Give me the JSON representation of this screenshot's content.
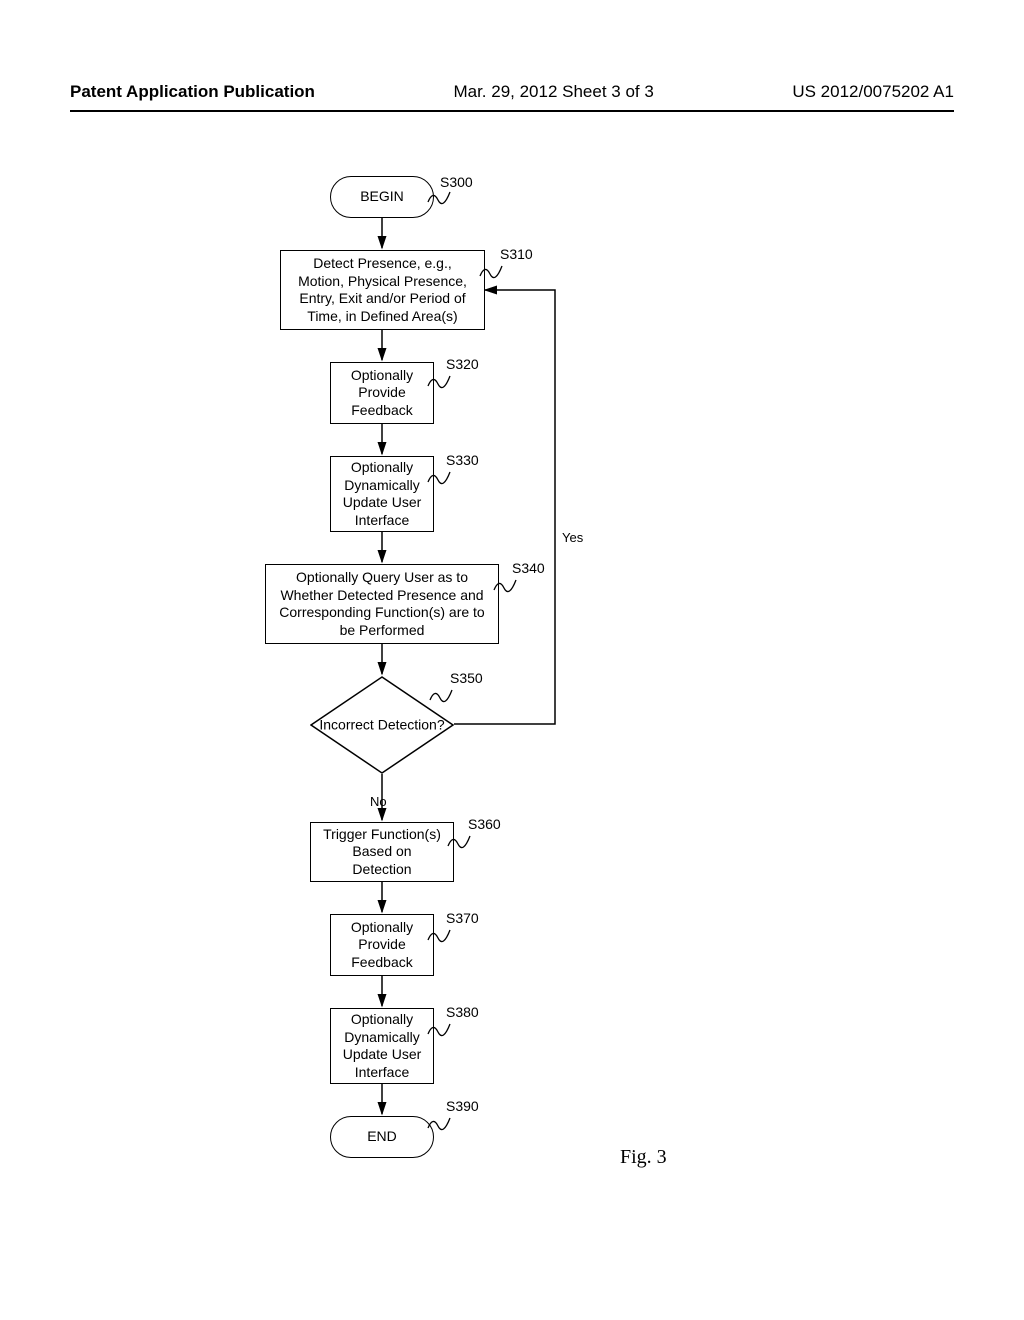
{
  "header": {
    "left": "Patent Application Publication",
    "center": "Mar. 29, 2012  Sheet 3 of 3",
    "right": "US 2012/0075202 A1"
  },
  "chart_data": {
    "type": "flowchart",
    "title": "Fig. 3",
    "nodes": [
      {
        "id": "S300",
        "kind": "terminator",
        "label": "BEGIN"
      },
      {
        "id": "S310",
        "kind": "process",
        "label": "Detect Presence, e.g., Motion, Physical Presence, Entry, Exit and/or Period of Time, in Defined Area(s)"
      },
      {
        "id": "S320",
        "kind": "process",
        "label": "Optionally Provide Feedback"
      },
      {
        "id": "S330",
        "kind": "process",
        "label": "Optionally Dynamically Update User Interface"
      },
      {
        "id": "S340",
        "kind": "process",
        "label": "Optionally Query User as to Whether Detected Presence and Corresponding Function(s) are to be Performed"
      },
      {
        "id": "S350",
        "kind": "decision",
        "label": "Incorrect Detection?"
      },
      {
        "id": "S360",
        "kind": "process",
        "label": "Trigger Function(s) Based on Detection"
      },
      {
        "id": "S370",
        "kind": "process",
        "label": "Optionally Provide Feedback"
      },
      {
        "id": "S380",
        "kind": "process",
        "label": "Optionally Dynamically Update User Interface"
      },
      {
        "id": "S390",
        "kind": "terminator",
        "label": "END"
      }
    ],
    "edges": [
      {
        "from": "S300",
        "to": "S310"
      },
      {
        "from": "S310",
        "to": "S320"
      },
      {
        "from": "S320",
        "to": "S330"
      },
      {
        "from": "S330",
        "to": "S340"
      },
      {
        "from": "S340",
        "to": "S350"
      },
      {
        "from": "S350",
        "to": "S360",
        "label": "No"
      },
      {
        "from": "S350",
        "to": "S310",
        "label": "Yes"
      },
      {
        "from": "S360",
        "to": "S370"
      },
      {
        "from": "S370",
        "to": "S380"
      },
      {
        "from": "S380",
        "to": "S390"
      }
    ]
  },
  "steps": {
    "s300": {
      "id": "S300",
      "label": "BEGIN"
    },
    "s310": {
      "id": "S310",
      "label": "Detect Presence, e.g., Motion, Physical Presence, Entry, Exit and/or Period of Time, in Defined Area(s)"
    },
    "s320": {
      "id": "S320",
      "label": "Optionally Provide Feedback"
    },
    "s330": {
      "id": "S330",
      "label": "Optionally Dynamically Update User Interface"
    },
    "s340": {
      "id": "S340",
      "label": "Optionally Query User as to Whether Detected Presence and Corresponding Function(s) are to be Performed"
    },
    "s350": {
      "id": "S350",
      "label": "Incorrect Detection?"
    },
    "s360": {
      "id": "S360",
      "label": "Trigger Function(s) Based on Detection"
    },
    "s370": {
      "id": "S370",
      "label": "Optionally Provide Feedback"
    },
    "s380": {
      "id": "S380",
      "label": "Optionally Dynamically Update User Interface"
    },
    "s390": {
      "id": "S390",
      "label": "END"
    }
  },
  "edge_labels": {
    "yes": "Yes",
    "no": "No"
  },
  "figure": {
    "caption": "Fig. 3"
  }
}
